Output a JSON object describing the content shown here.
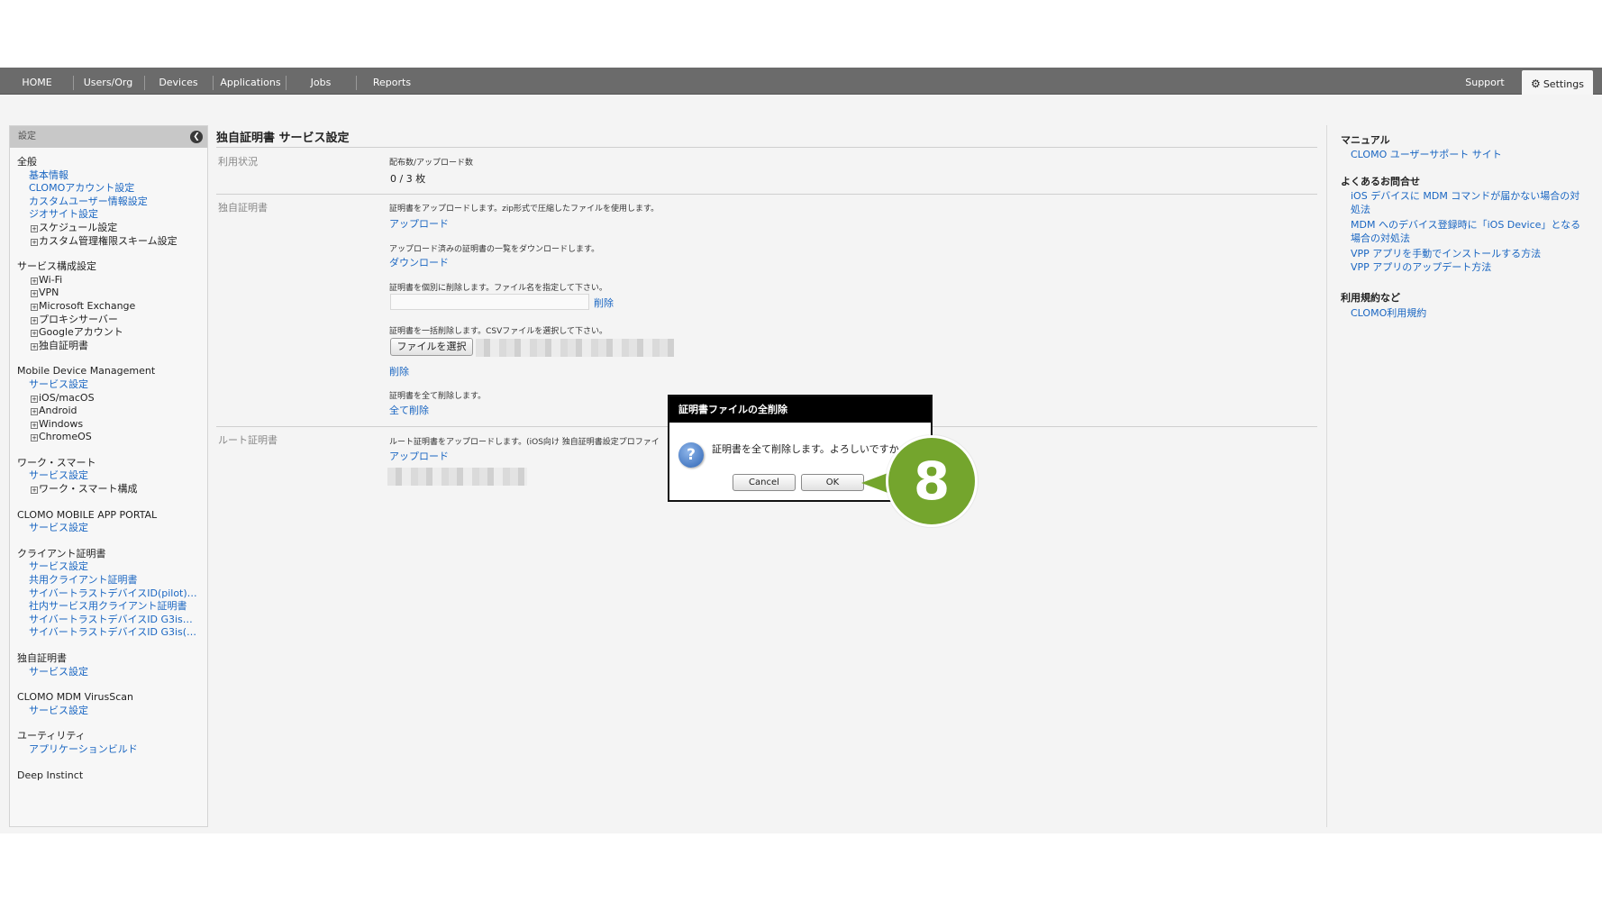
{
  "nav": {
    "items": [
      "HOME",
      "Users/Org",
      "Devices",
      "Applications",
      "Jobs",
      "Reports"
    ],
    "support": "Support",
    "settings": "Settings"
  },
  "sidebar": {
    "header": "設定",
    "sections": [
      {
        "title": "全般",
        "items": [
          {
            "kind": "link",
            "label": "基本情報"
          },
          {
            "kind": "link",
            "label": "CLOMOアカウント設定"
          },
          {
            "kind": "link",
            "label": "カスタムユーザー情報設定"
          },
          {
            "kind": "link",
            "label": "ジオサイト設定"
          },
          {
            "kind": "expand",
            "label": "スケジュール設定"
          },
          {
            "kind": "expand",
            "label": "カスタム管理権限スキーム設定"
          }
        ]
      },
      {
        "title": "サービス構成設定",
        "items": [
          {
            "kind": "expand",
            "label": "Wi-Fi"
          },
          {
            "kind": "expand",
            "label": "VPN"
          },
          {
            "kind": "expand",
            "label": "Microsoft Exchange"
          },
          {
            "kind": "expand",
            "label": "プロキシサーバー"
          },
          {
            "kind": "expand",
            "label": "Googleアカウント"
          },
          {
            "kind": "expand",
            "label": "独自証明書"
          }
        ]
      },
      {
        "title": "Mobile Device Management",
        "items": [
          {
            "kind": "link",
            "label": "サービス設定"
          },
          {
            "kind": "expand",
            "label": "iOS/macOS"
          },
          {
            "kind": "expand",
            "label": "Android"
          },
          {
            "kind": "expand",
            "label": "Windows"
          },
          {
            "kind": "expand",
            "label": "ChromeOS"
          }
        ]
      },
      {
        "title": "ワーク・スマート",
        "items": [
          {
            "kind": "link",
            "label": "サービス設定"
          },
          {
            "kind": "expand",
            "label": "ワーク・スマート構成"
          }
        ]
      },
      {
        "title": "CLOMO MOBILE APP PORTAL",
        "items": [
          {
            "kind": "link",
            "label": "サービス設定"
          }
        ]
      },
      {
        "title": "クライアント証明書",
        "items": [
          {
            "kind": "link",
            "label": "サービス設定"
          },
          {
            "kind": "link",
            "label": "共用クライアント証明書"
          },
          {
            "kind": "link",
            "label": "サイバートラストデバイスID(pilot)…"
          },
          {
            "kind": "link",
            "label": "社内サービス用クライアント証明書"
          },
          {
            "kind": "link",
            "label": "サイバートラストデバイスID G3is…"
          },
          {
            "kind": "link",
            "label": "サイバートラストデバイスID G3is(…"
          }
        ]
      },
      {
        "title": "独自証明書",
        "items": [
          {
            "kind": "link",
            "label": "サービス設定"
          }
        ]
      },
      {
        "title": "CLOMO MDM VirusScan",
        "items": [
          {
            "kind": "link",
            "label": "サービス設定"
          }
        ]
      },
      {
        "title": "ユーティリティ",
        "items": [
          {
            "kind": "link",
            "label": "アプリケーションビルド"
          }
        ]
      },
      {
        "title": "Deep Instinct",
        "items": []
      }
    ]
  },
  "main": {
    "title": "独自証明書 サービス設定",
    "usage": {
      "label": "利用状況",
      "caption": "配布数/アップロード数",
      "value": "0 / 3 枚"
    },
    "cert": {
      "label": "独自証明書",
      "upload_desc": "証明書をアップロードします。zip形式で圧縮したファイルを使用します。",
      "upload_link": "アップロード",
      "download_desc": "アップロード済みの証明書の一覧をダウンロードします。",
      "download_link": "ダウンロード",
      "delete_one_desc": "証明書を個別に削除します。ファイル名を指定して下さい。",
      "delete_one_link": "削除",
      "bulk_desc": "証明書を一括削除します。CSVファイルを選択して下さい。",
      "file_button": "ファイルを選択",
      "bulk_link": "削除",
      "delete_all_desc": "証明書を全て削除します。",
      "delete_all_link": "全て削除"
    },
    "root": {
      "label": "ルート証明書",
      "desc": "ルート証明書をアップロードします。(iOS向け 独自証明書設定プロファイ",
      "upload_link": "アップロード"
    }
  },
  "right": {
    "manual_title": "マニュアル",
    "manual_link": "CLOMO ユーザーサポート サイト",
    "faq_title": "よくあるお問合せ",
    "faq_links": [
      "iOS デバイスに MDM コマンドが届かない場合の対処法",
      "MDM へのデバイス登録時に「iOS Device」となる場合の対処法",
      "VPP アプリを手動でインストールする方法",
      "VPP アプリのアップデート方法"
    ],
    "terms_title": "利用規約など",
    "terms_link": "CLOMO利用規約"
  },
  "dialog": {
    "title": "証明書ファイルの全削除",
    "message": "証明書を全て削除します。よろしいですか",
    "cancel": "Cancel",
    "ok": "OK",
    "icon": "question-icon"
  },
  "callout": {
    "number": "8",
    "color": "#74a52d"
  }
}
